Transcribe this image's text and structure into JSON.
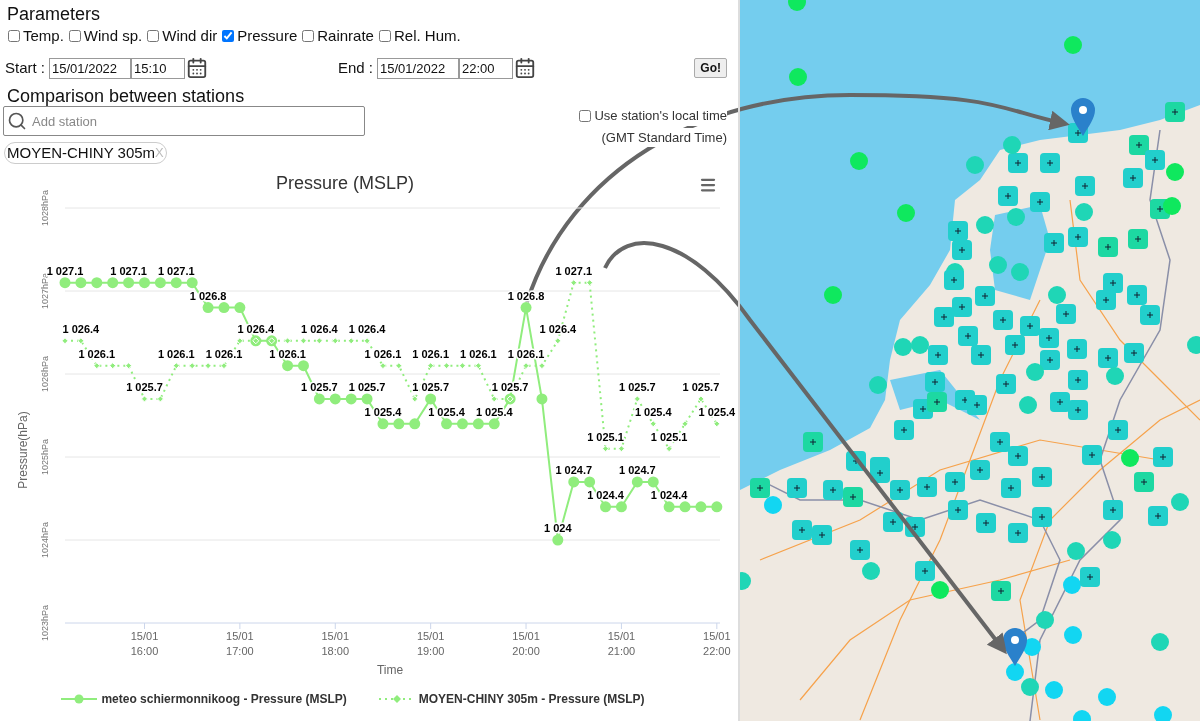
{
  "parameters": {
    "title": "Parameters",
    "options": [
      {
        "label": "Temp.",
        "checked": false
      },
      {
        "label": "Wind sp.",
        "checked": false
      },
      {
        "label": "Wind dir",
        "checked": false
      },
      {
        "label": "Pressure",
        "checked": true
      },
      {
        "label": "Rainrate",
        "checked": false
      },
      {
        "label": "Rel. Hum.",
        "checked": false
      }
    ]
  },
  "period": {
    "start_label": "Start :",
    "start_date": "15/01/2022",
    "start_time": "15:10",
    "end_label": "End :",
    "end_date": "15/01/2022",
    "end_time": "22:00",
    "go_button": "Go!"
  },
  "comparison": {
    "title": "Comparison between stations",
    "search": {
      "placeholder": "Add station"
    },
    "local_time": {
      "label": "Use station's local time",
      "checked": false,
      "timezone": "(GMT Standard Time)"
    },
    "stations": [
      {
        "name": "MOYEN-CHINY 305m",
        "remove": "X"
      }
    ]
  },
  "chart": {
    "chart_data": {
      "type": "line",
      "title": "Pressure (MSLP)",
      "xlabel": "Time",
      "ylabel": "Pressure(hPa)",
      "categories": [
        null,
        null,
        null,
        null,
        null,
        "15/01 16:00",
        null,
        null,
        null,
        null,
        null,
        "15/01 17:00",
        null,
        null,
        null,
        null,
        null,
        "15/01 18:00",
        null,
        null,
        null,
        null,
        null,
        "15/01 19:00",
        null,
        null,
        null,
        null,
        null,
        "15/01 20:00",
        null,
        null,
        null,
        null,
        null,
        "15/01 21:00",
        null,
        null,
        null,
        null,
        null,
        "15/01 22:00"
      ],
      "ylim": [
        1023,
        1028
      ],
      "grid": true,
      "legend": true,
      "yticks": [
        {
          "value": 1023,
          "label": "1023hPa"
        },
        {
          "value": 1024,
          "label": "1024hPa"
        },
        {
          "value": 1025,
          "label": "1025hPa"
        },
        {
          "value": 1026,
          "label": "1026hPa"
        },
        {
          "value": 1027,
          "label": "1027hPa"
        },
        {
          "value": 1028,
          "label": "1028hPa"
        }
      ],
      "series": [
        {
          "name": "meteo schiermonnikoog - Pressure (MSLP)",
          "color": "#90ed7d",
          "line_style": "solid",
          "marker": "circle",
          "values": [
            1027.1,
            1027.1,
            1027.1,
            1027.1,
            1027.1,
            1027.1,
            1027.1,
            1027.1,
            1027.1,
            1026.8,
            1026.8,
            1026.8,
            1026.4,
            1026.4,
            1026.1,
            1026.1,
            1025.7,
            1025.7,
            1025.7,
            1025.7,
            1025.4,
            1025.4,
            1025.4,
            1025.7,
            1025.4,
            1025.4,
            1025.4,
            1025.4,
            1025.7,
            1026.8,
            1025.7,
            1024,
            1024.7,
            1024.7,
            1024.4,
            1024.4,
            1024.7,
            1024.7,
            1024.4,
            1024.4,
            1024.4,
            1024.4
          ]
        },
        {
          "name": "MOYEN-CHINY 305m - Pressure (MSLP)",
          "color": "#90ed7d",
          "line_style": "dotted",
          "marker": "diamond",
          "values": [
            1026.4,
            1026.4,
            1026.1,
            1026.1,
            1026.1,
            1025.7,
            1025.7,
            1026.1,
            1026.1,
            1026.1,
            1026.1,
            1026.4,
            1026.4,
            1026.4,
            1026.4,
            1026.4,
            1026.4,
            1026.4,
            1026.4,
            1026.4,
            1026.1,
            1026.1,
            1025.7,
            1026.1,
            1026.1,
            1026.1,
            1026.1,
            1025.7,
            1025.7,
            1026.1,
            1026.1,
            1026.4,
            1027.1,
            1027.1,
            1025.1,
            1025.1,
            1025.7,
            1025.4,
            1025.1,
            1025.4,
            1025.7,
            1025.4
          ]
        }
      ],
      "value_labels": [
        [
          "1 027.1",
          null,
          null,
          null,
          "1 027.1",
          null,
          null,
          "1 027.1",
          null,
          "1 026.8",
          null,
          null,
          "1 026.4",
          null,
          "1 026.1",
          null,
          "1 025.7",
          null,
          null,
          "1 025.7",
          "1 025.4",
          null,
          null,
          "1 025.7",
          "1 025.4",
          null,
          null,
          "1 025.4",
          "1 025.7",
          "1 026.8",
          null,
          "1 024",
          "1 024.7",
          null,
          "1 024.4",
          null,
          "1 024.7",
          null,
          "1 024.4",
          null,
          null,
          null
        ],
        [
          null,
          "1 026.4",
          "1 026.1",
          null,
          null,
          "1 025.7",
          null,
          "1 026.1",
          null,
          null,
          "1 026.1",
          null,
          null,
          null,
          null,
          null,
          "1 026.4",
          null,
          null,
          "1 026.4",
          "1 026.1",
          null,
          null,
          "1 026.1",
          null,
          null,
          "1 026.1",
          null,
          null,
          "1 026.1",
          null,
          "1 026.4",
          "1 027.1",
          null,
          "1 025.1",
          null,
          "1 025.7",
          "1 025.4",
          "1 025.1",
          null,
          "1 025.7",
          "1 025.4"
        ]
      ]
    }
  }
}
